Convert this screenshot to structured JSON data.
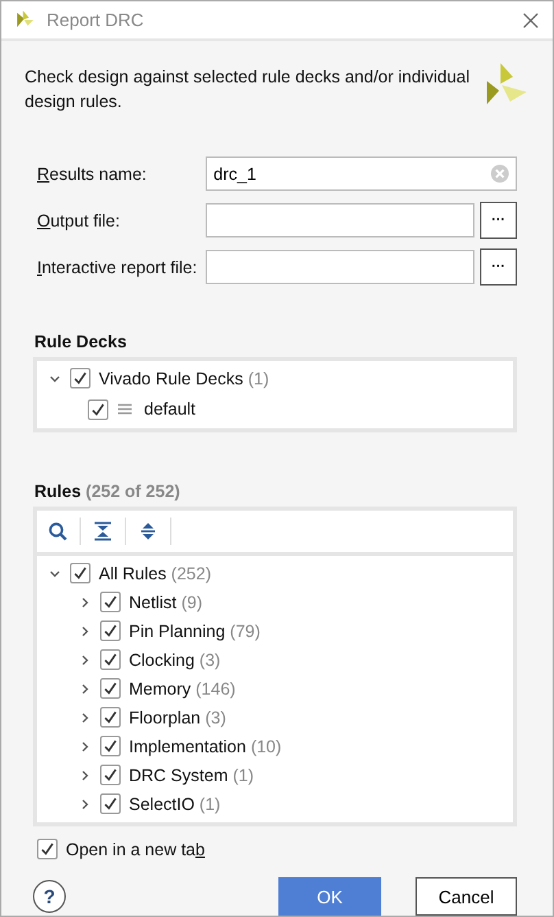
{
  "window": {
    "title": "Report DRC"
  },
  "description": "Check design against selected rule decks and/or individual design rules.",
  "fields": [
    {
      "label_key": "R",
      "label_post": "esults name:",
      "value": "drc_1",
      "kind": "clearable"
    },
    {
      "label_key": "O",
      "label_post": "utput file:",
      "kind": "browse",
      "browse_label": "···"
    },
    {
      "label_key": "I",
      "label_post": "nteractive report file:",
      "kind": "browse",
      "browse_label": "···"
    }
  ],
  "rule_decks": {
    "heading": "Rule Decks",
    "items": [
      {
        "name": "Vivado Rule Decks",
        "count": "(1)",
        "checked": true,
        "expanded": true,
        "children": [
          {
            "name": "default",
            "checked": true,
            "kind": "deck"
          }
        ]
      }
    ]
  },
  "rules": {
    "heading": "Rules",
    "count": "(252 of 252)",
    "root": {
      "name": "All Rules",
      "count": "(252)",
      "checked": true,
      "expanded": true,
      "children": [
        {
          "name": "Netlist",
          "count": "(9)",
          "checked": true,
          "expanded": false
        },
        {
          "name": "Pin Planning",
          "count": "(79)",
          "checked": true,
          "expanded": false
        },
        {
          "name": "Clocking",
          "count": "(3)",
          "checked": true,
          "expanded": false
        },
        {
          "name": "Memory",
          "count": "(146)",
          "checked": true,
          "expanded": false
        },
        {
          "name": "Floorplan",
          "count": "(3)",
          "checked": true,
          "expanded": false
        },
        {
          "name": "Implementation",
          "count": "(10)",
          "checked": true,
          "expanded": false
        },
        {
          "name": "DRC System",
          "count": "(1)",
          "checked": true,
          "expanded": false
        },
        {
          "name": "SelectIO",
          "count": "(1)",
          "checked": true,
          "expanded": false
        }
      ]
    }
  },
  "open_new_tab": {
    "label_pre": "Open in a new ta",
    "label_key": "b",
    "checked": true
  },
  "buttons": {
    "help": "?",
    "ok": "OK",
    "cancel": "Cancel"
  }
}
